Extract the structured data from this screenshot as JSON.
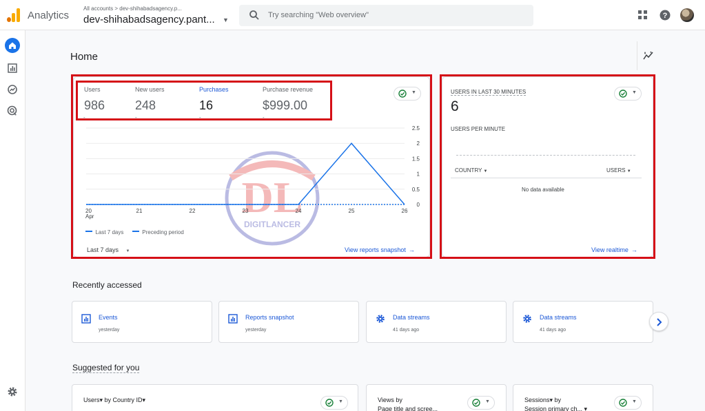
{
  "app": {
    "name": "Analytics",
    "brand_colors": [
      "#f9ab00",
      "#e37400"
    ]
  },
  "account": {
    "crumb_all": "All accounts",
    "crumb_sep": ">",
    "crumb_account": "dev-shihabadsagency.p...",
    "property": "dev-shihabadsagency.pant..."
  },
  "search": {
    "placeholder": "Try searching \"Web overview\""
  },
  "header_icons": [
    "apps-icon",
    "help-icon",
    "avatar"
  ],
  "nav": [
    "home-icon",
    "reports-icon",
    "explore-icon",
    "advertising-icon",
    "settings-icon"
  ],
  "page": {
    "title": "Home"
  },
  "overview": {
    "metrics": [
      {
        "label": "Users",
        "value": "986",
        "selected": false
      },
      {
        "label": "New users",
        "value": "248",
        "selected": false
      },
      {
        "label": "Purchases",
        "value": "16",
        "selected": true
      },
      {
        "label": "Purchase revenue",
        "value": "$999.00",
        "selected": false
      }
    ],
    "metric_dash": "-",
    "date_range": "Last 7 days",
    "link": "View reports snapshot"
  },
  "chart_data": {
    "type": "line",
    "x": [
      "20",
      "21",
      "22",
      "23",
      "24",
      "25",
      "26"
    ],
    "x_sub": "Apr",
    "yticks": [
      "0",
      "0.5",
      "1",
      "1.5",
      "2",
      "2.5"
    ],
    "ylim": [
      0,
      2.5
    ],
    "grid": true,
    "series": [
      {
        "name": "Last 7 days",
        "values": [
          0,
          0,
          0,
          0,
          0,
          2,
          0
        ],
        "color": "#1a73e8",
        "style": "solid"
      },
      {
        "name": "Preceding period",
        "values": [
          0,
          0,
          0,
          0,
          0,
          0,
          0
        ],
        "color": "#1a73e8",
        "style": "dashed"
      }
    ],
    "legend_position": "bottom-left"
  },
  "realtime": {
    "title": "USERS IN LAST 30 MINUTES",
    "value": "6",
    "per_minute": "USERS PER MINUTE",
    "col_country": "COUNTRY",
    "col_users": "USERS",
    "empty": "No data available",
    "link": "View realtime"
  },
  "recent": {
    "title": "Recently accessed",
    "items": [
      {
        "title": "Events",
        "sub": "yesterday",
        "icon": "report-icon"
      },
      {
        "title": "Reports snapshot",
        "sub": "yesterday",
        "icon": "report-icon"
      },
      {
        "title": "Data streams",
        "sub": "41 days ago",
        "icon": "settings-icon"
      },
      {
        "title": "Data streams",
        "sub": "41 days ago",
        "icon": "settings-icon"
      }
    ]
  },
  "suggested": {
    "title": "Suggested for you",
    "cards": [
      {
        "line1": "Users▾ by Country ID▾",
        "line2": ""
      },
      {
        "line1": "Views by",
        "line2": "Page title and scree..."
      },
      {
        "line1": "Sessions▾ by",
        "line2": "Session primary ch... ▾"
      }
    ]
  },
  "watermark": {
    "text": "DIGITLANCER",
    "mark": "DL"
  }
}
